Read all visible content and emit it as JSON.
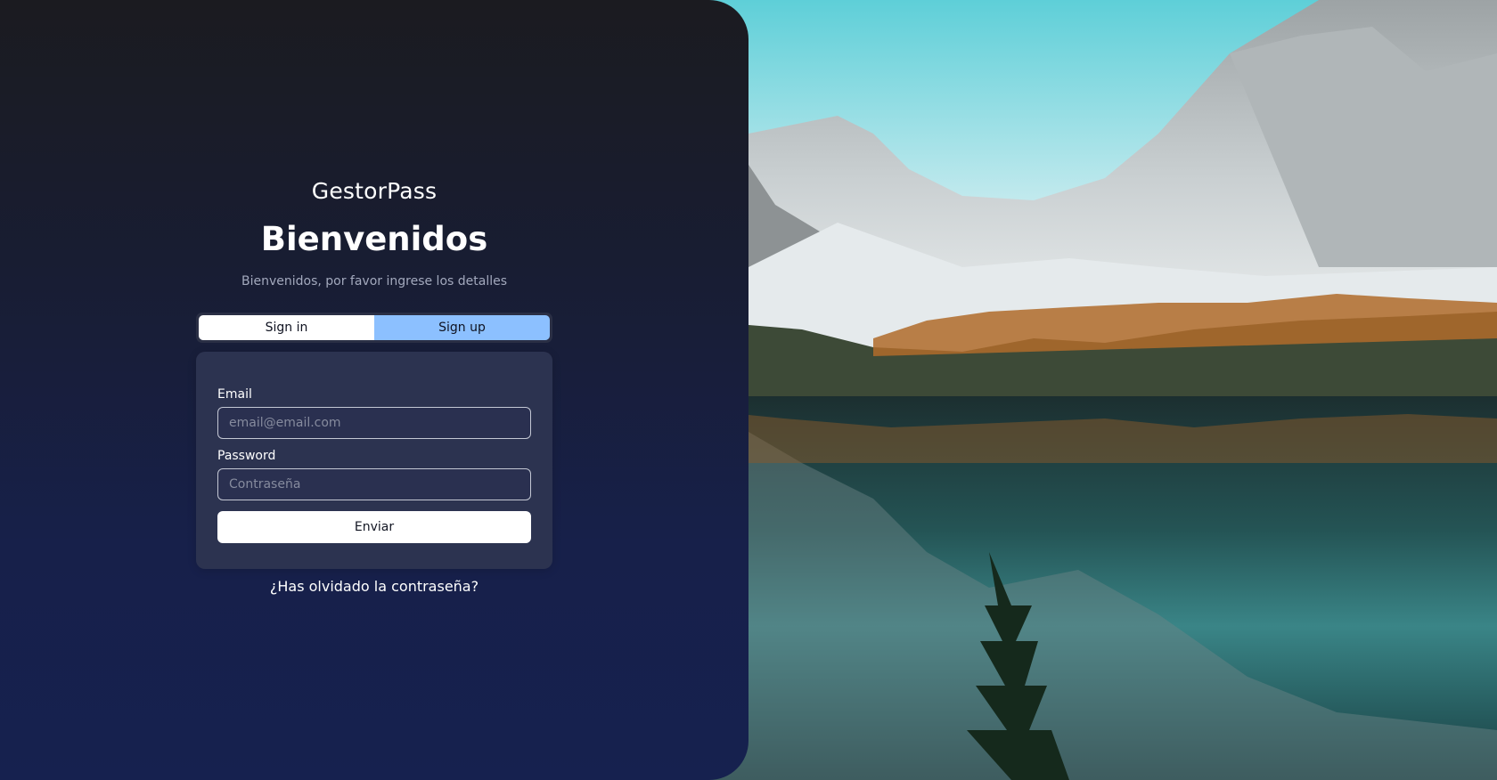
{
  "brand": {
    "name": "GestorPass"
  },
  "header": {
    "title": "Bienvenidos",
    "subtitle": "Bienvenidos, por favor ingrese los detalles"
  },
  "tabs": [
    {
      "label": "Sign in",
      "active": true
    },
    {
      "label": "Sign up",
      "active": false
    }
  ],
  "form": {
    "email_label": "Email",
    "email_placeholder": "email@email.com",
    "email_value": "",
    "password_label": "Password",
    "password_placeholder": "Contraseña",
    "password_value": "",
    "submit_label": "Enviar"
  },
  "links": {
    "forgot_password": "¿Has olvidado la contraseña?"
  },
  "colors": {
    "panel_top": "#1b1b20",
    "panel_bottom": "#16214f",
    "card_bg": "#2c3350",
    "signup_tab": "#8cc0ff",
    "button_bg": "#ffffff"
  }
}
